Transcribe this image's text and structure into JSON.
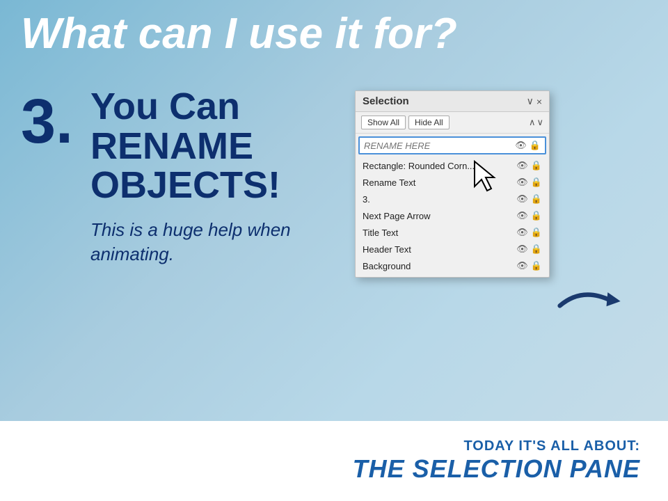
{
  "page": {
    "heading": "What can I use it for?",
    "step_number": "3.",
    "step_main": "You Can RENAME OBJECTS!",
    "step_sub": "This is a huge help when animating.",
    "bottom_label": "TODAY IT'S ALL ABOUT:",
    "bottom_title": "THE SELECTION PANE"
  },
  "selection_panel": {
    "title": "Selection",
    "controls": {
      "chevron_down": "∨",
      "close": "×"
    },
    "toolbar": {
      "show_all": "Show All",
      "hide_all": "Hide All",
      "up_arrow": "∧",
      "down_arrow": "∨"
    },
    "rename_placeholder": "RENAME HERE",
    "items": [
      {
        "name": "Rectangle: Rounded Corn...",
        "visible": true,
        "locked": false
      },
      {
        "name": "Rename Text",
        "visible": true,
        "locked": false
      },
      {
        "name": "3.",
        "visible": true,
        "locked": false
      },
      {
        "name": "Next Page Arrow",
        "visible": true,
        "locked": false
      },
      {
        "name": "Title Text",
        "visible": true,
        "locked": false
      },
      {
        "name": "Header Text",
        "visible": true,
        "locked": false
      },
      {
        "name": "Background",
        "visible": true,
        "locked": false
      }
    ]
  }
}
